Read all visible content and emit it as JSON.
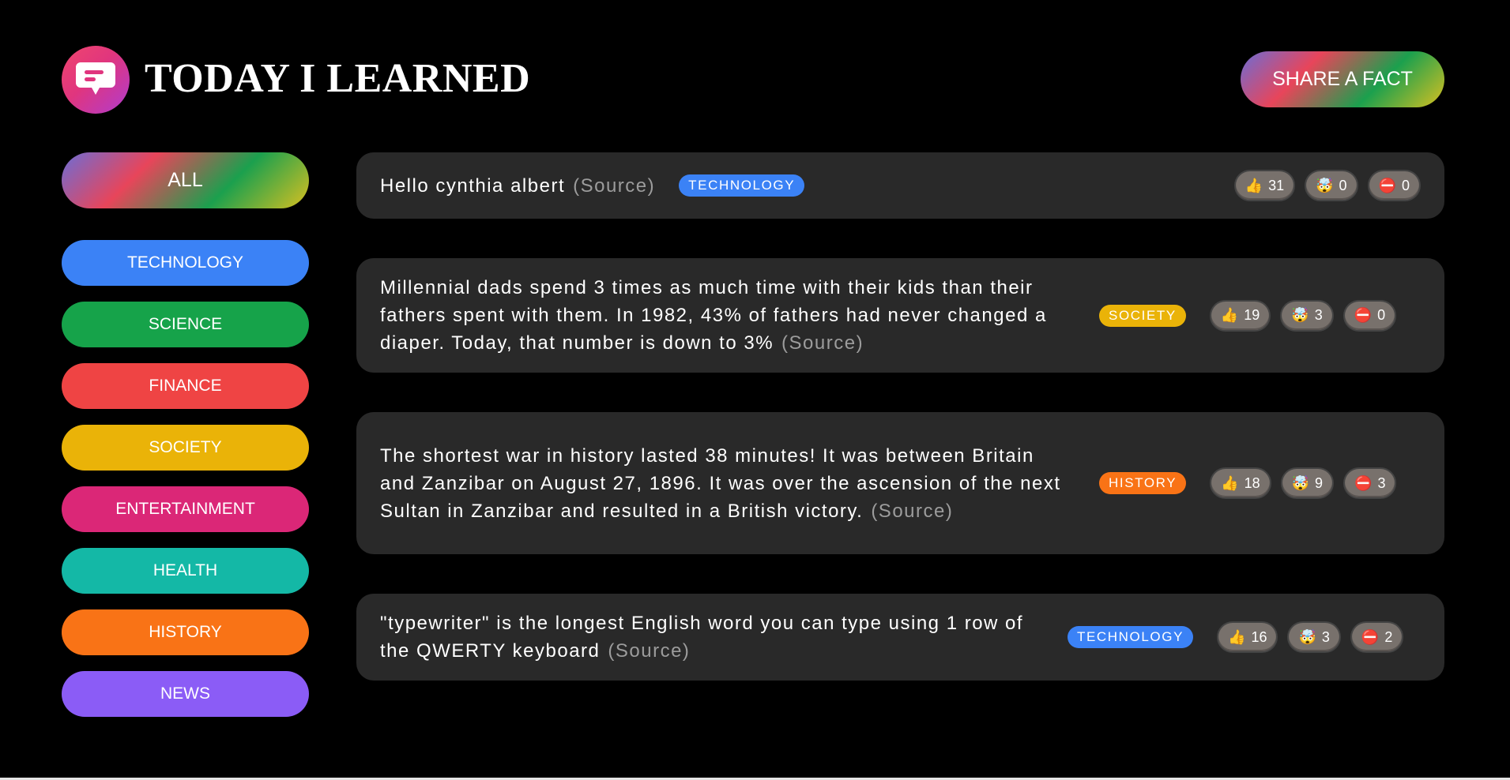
{
  "header": {
    "title": "TODAY I LEARNED",
    "share_label": "SHARE A FACT"
  },
  "sidebar": {
    "all_label": "ALL",
    "categories": [
      {
        "label": "TECHNOLOGY",
        "color": "#3b82f6"
      },
      {
        "label": "SCIENCE",
        "color": "#16a34a"
      },
      {
        "label": "FINANCE",
        "color": "#ef4444"
      },
      {
        "label": "SOCIETY",
        "color": "#eab308"
      },
      {
        "label": "ENTERTAINMENT",
        "color": "#db2777"
      },
      {
        "label": "HEALTH",
        "color": "#14b8a6"
      },
      {
        "label": "HISTORY",
        "color": "#f97316"
      },
      {
        "label": "NEWS",
        "color": "#8b5cf6"
      }
    ]
  },
  "facts": [
    {
      "text": "Hello cynthia albert",
      "source": "(Source)",
      "category": "TECHNOLOGY",
      "category_color": "#3b82f6",
      "likes": "31",
      "mindblowing": "0",
      "false": "0"
    },
    {
      "text": "Millennial dads spend 3 times as much time with their kids than their fathers spent with them. In 1982, 43% of fathers had never changed a diaper. Today, that number is down to 3%",
      "source": "(Source)",
      "category": "SOCIETY",
      "category_color": "#eab308",
      "likes": "19",
      "mindblowing": "3",
      "false": "0"
    },
    {
      "text": "The shortest war in history lasted 38 minutes! It was between Britain and Zanzibar on August 27, 1896. It was over the ascension of the next Sultan in Zanzibar and resulted in a British victory.",
      "source": "(Source)",
      "category": "HISTORY",
      "category_color": "#f97316",
      "likes": "18",
      "mindblowing": "9",
      "false": "3"
    },
    {
      "text": "\"typewriter\" is the longest English word you can type using 1 row of the QWERTY keyboard",
      "source": "(Source)",
      "category": "TECHNOLOGY",
      "category_color": "#3b82f6",
      "likes": "16",
      "mindblowing": "3",
      "false": "2"
    }
  ],
  "icons": {
    "like": "👍",
    "mindblowing": "🤯",
    "false": "⛔"
  }
}
